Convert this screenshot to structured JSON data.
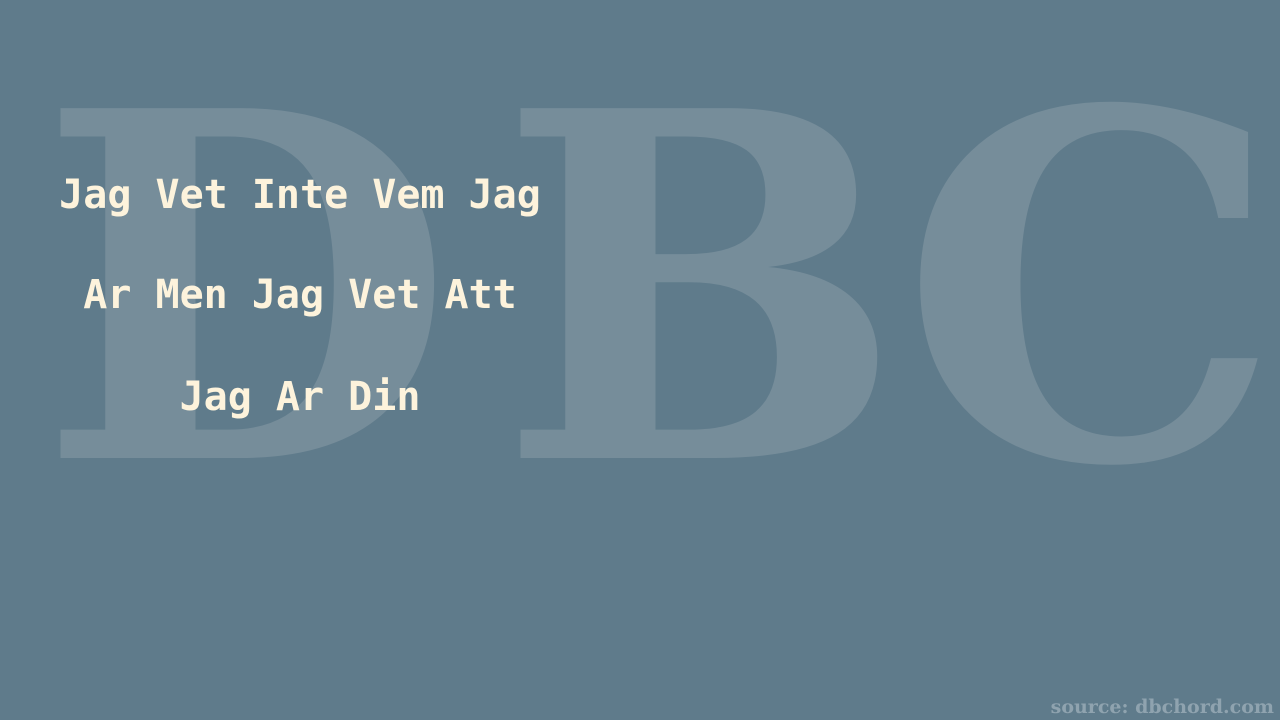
{
  "watermark": "DBC",
  "lyrics": [
    "Jag Vet Inte Vem Jag",
    "Ar Men Jag Vet Att",
    "Jag Ar Din"
  ],
  "source": "source: dbchord.com"
}
